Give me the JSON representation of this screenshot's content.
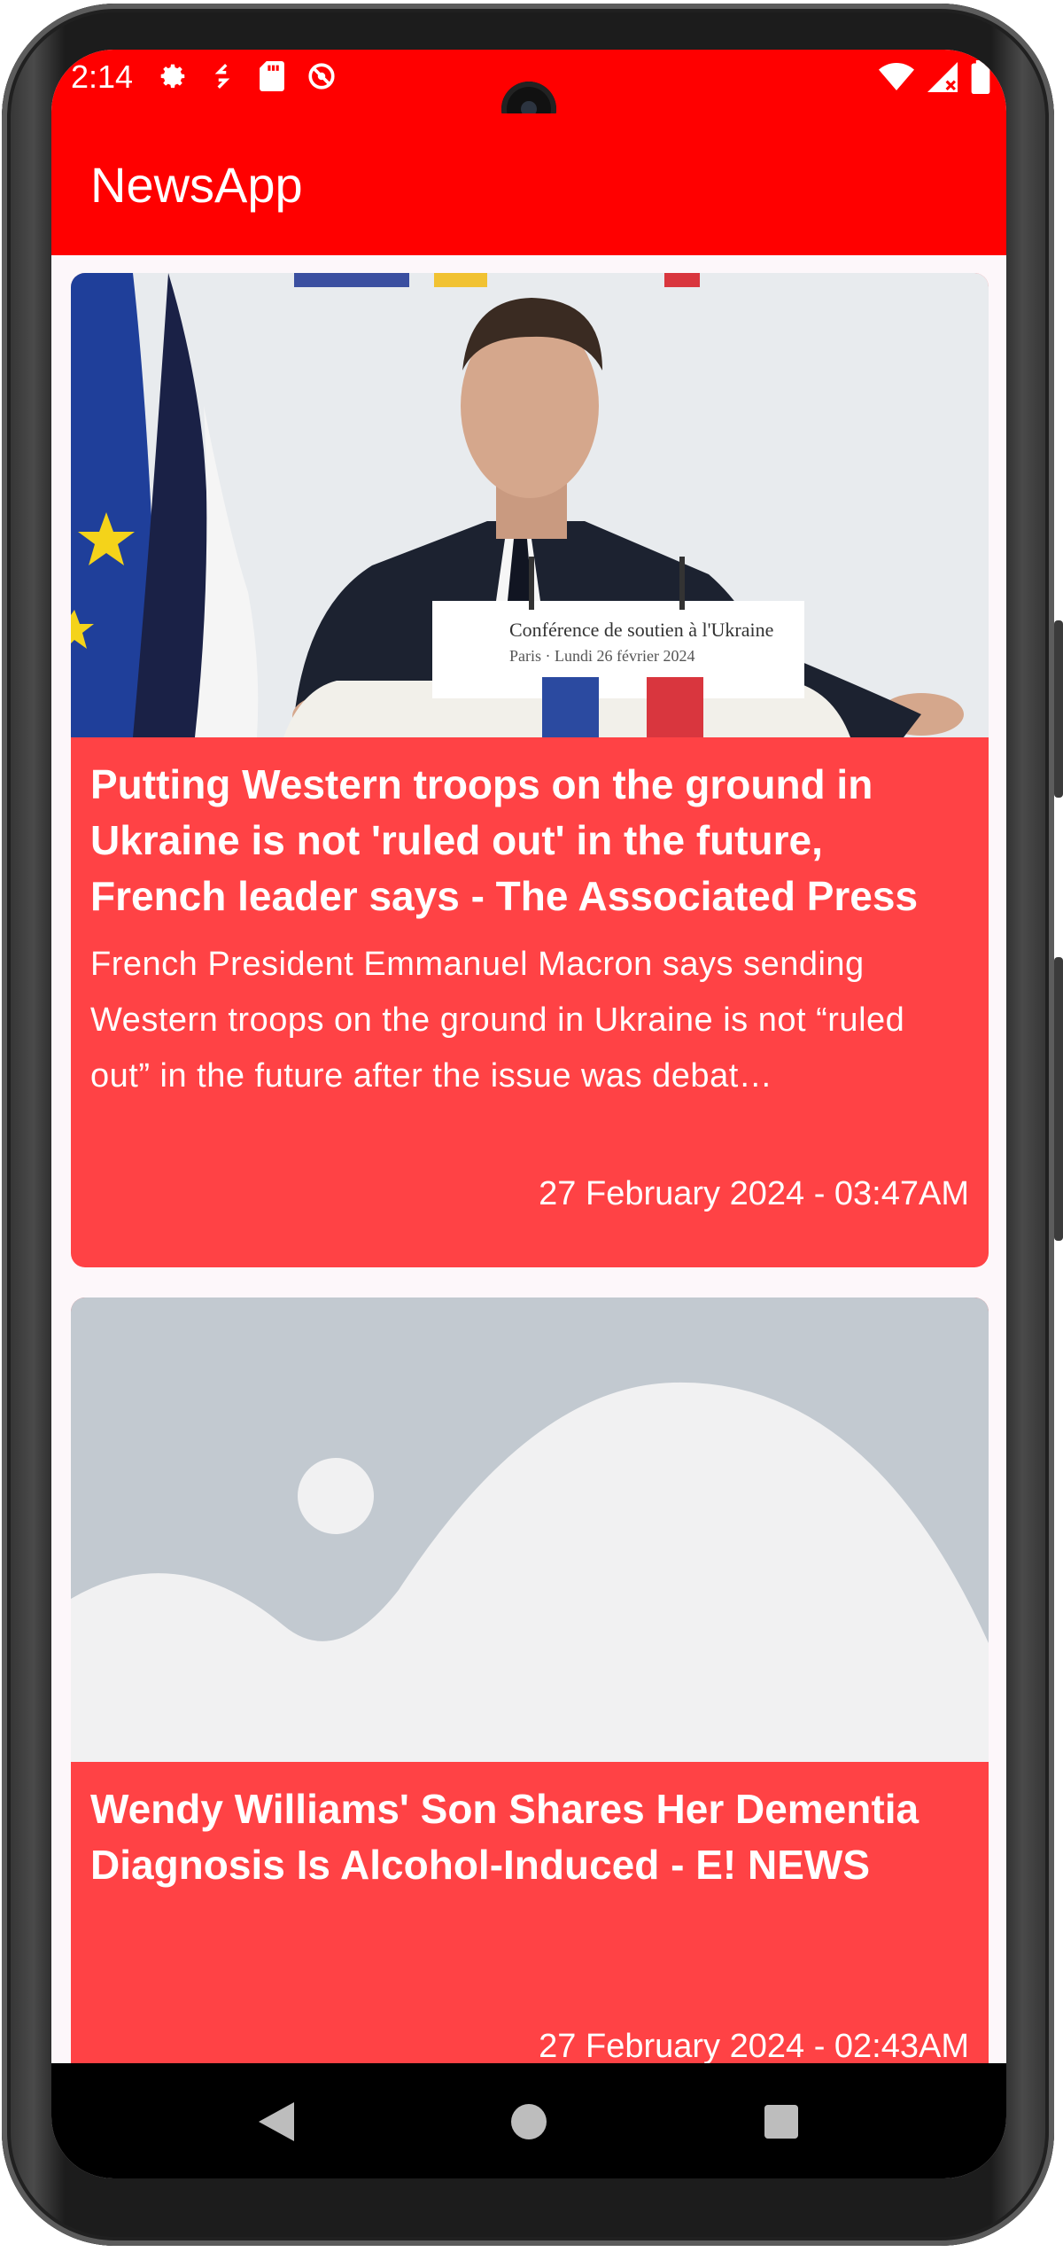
{
  "status_bar": {
    "time": "2:14",
    "left_icons": [
      "settings-icon",
      "sync-icon",
      "sd-card-icon",
      "do-not-disturb-icon"
    ],
    "right_icons": [
      "wifi-icon",
      "signal-icon",
      "battery-icon"
    ]
  },
  "app_bar": {
    "title": "NewsApp",
    "color": "#ff0000"
  },
  "articles": [
    {
      "title": "Putting Western troops on the ground in Ukraine is not 'ruled out' in the future, French leader says - The Associated Press",
      "description": "French President Emmanuel Macron says sending Western troops on the ground in Ukraine is not “ruled out” in the future after the issue was debat…",
      "date": "27 February 2024 - 03:47AM",
      "image": "news-photo",
      "podium_sign_line1": "Conférence de soutien à l'Ukraine",
      "podium_sign_line2": "Paris · Lundi 26 février 2024"
    },
    {
      "title": "Wendy Williams' Son Shares Her Dementia Diagnosis Is Alcohol-Induced - E! NEWS",
      "description": "",
      "date": "27 February 2024 - 02:43AM",
      "image": "image-placeholder-icon"
    }
  ],
  "colors": {
    "card_background": "#ff4245",
    "screen_background": "#fdf7fa",
    "placeholder_bg": "#c2c9d0",
    "placeholder_fg": "#f1f1f2"
  },
  "nav_bar": {
    "buttons": [
      "back-icon",
      "home-icon",
      "recents-icon"
    ]
  }
}
